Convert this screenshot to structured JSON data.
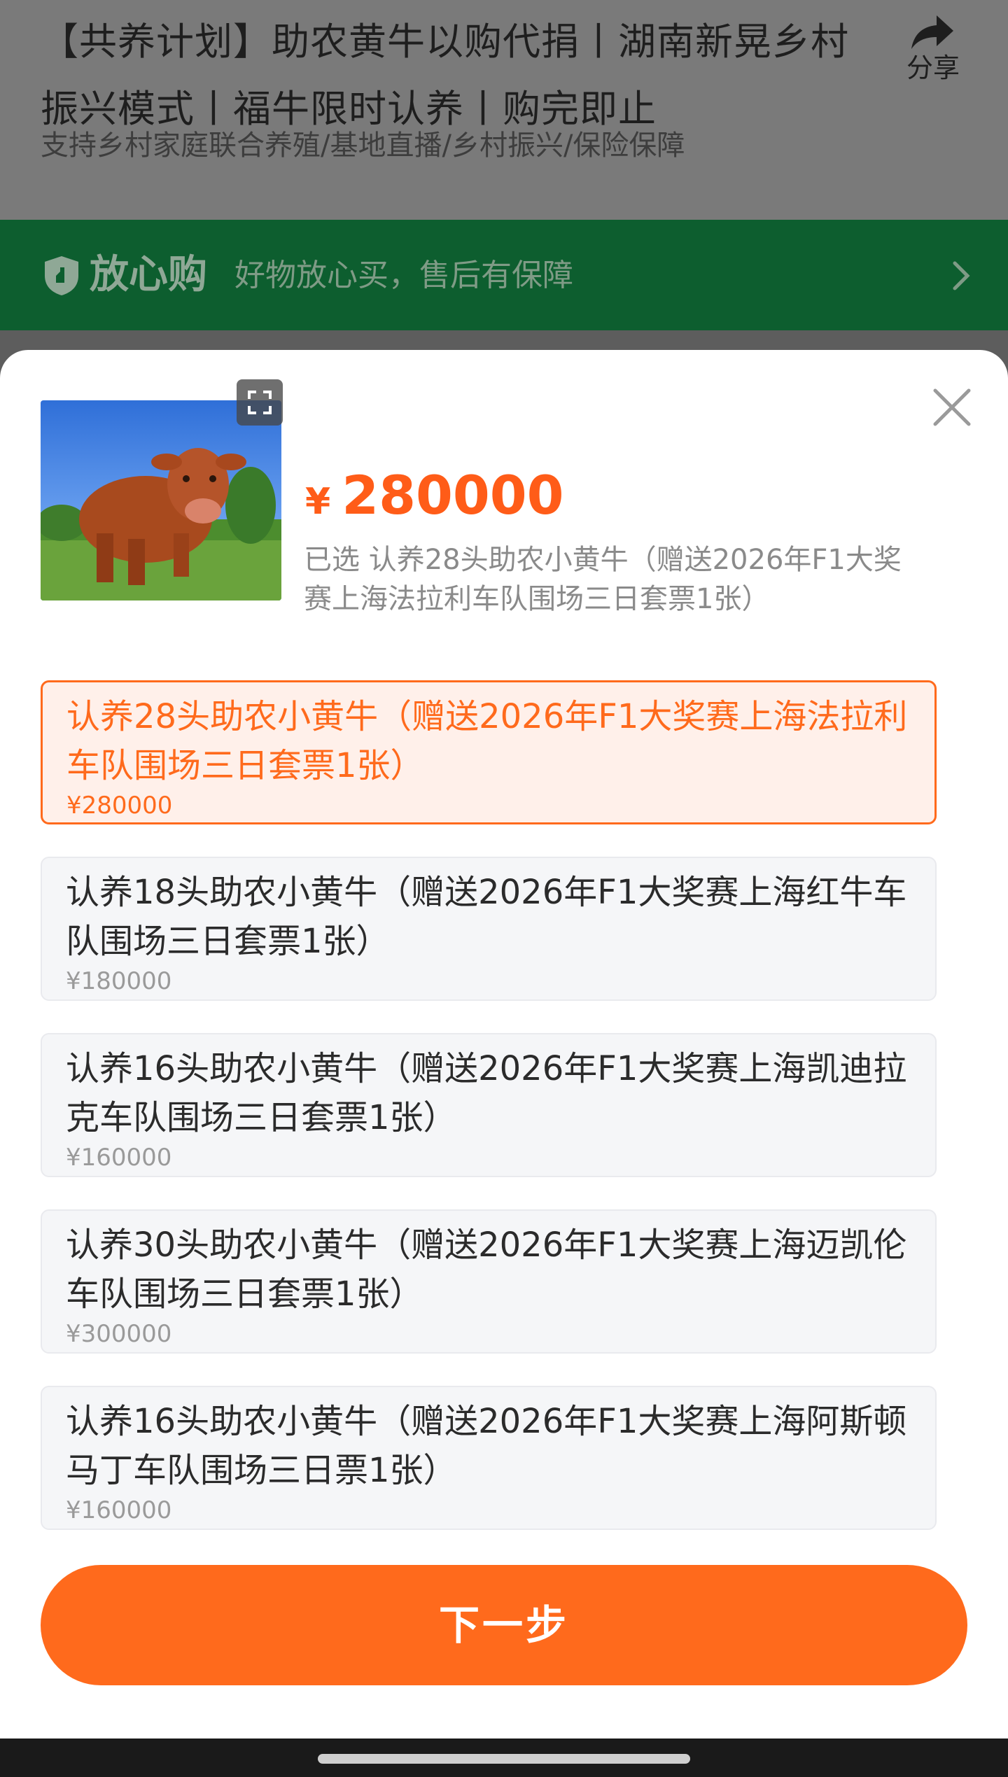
{
  "background": {
    "title": "【共养计划】助农黄牛以购代捐丨湖南新晃乡村振兴模式丨福牛限时认养丨购完即止",
    "subtitle": "支持乡村家庭联合养殖/基地直播/乡村振兴/保险保障",
    "share_label": "分享",
    "assurance": {
      "title": "放心购",
      "description": "好物放心买，售后有保障"
    }
  },
  "sheet": {
    "currency": "¥",
    "price": "280000",
    "selected_text": "已选 认养28头助农小黄牛（赠送2026年F1大奖赛上海法拉利车队围场三日套票1张）",
    "options": [
      {
        "name": "认养28头助农小黄牛（赠送2026年F1大奖赛上海法拉利车队围场三日套票1张）",
        "price": "¥280000",
        "selected": true
      },
      {
        "name": "认养18头助农小黄牛（赠送2026年F1大奖赛上海红牛车队围场三日套票1张）",
        "price": "¥180000",
        "selected": false
      },
      {
        "name": "认养16头助农小黄牛（赠送2026年F1大奖赛上海凯迪拉克车队围场三日套票1张）",
        "price": "¥160000",
        "selected": false
      },
      {
        "name": "认养30头助农小黄牛（赠送2026年F1大奖赛上海迈凯伦车队围场三日套票1张）",
        "price": "¥300000",
        "selected": false
      },
      {
        "name": "认养16头助农小黄牛（赠送2026年F1大奖赛上海阿斯顿马丁车队围场三日票1张）",
        "price": "¥160000",
        "selected": false
      }
    ],
    "next_button": "下一步"
  },
  "colors": {
    "accent": "#ff6a1c",
    "assurance_bar": "#0d5e2f",
    "selected_bg": "#fff0ea"
  },
  "icons": [
    "share-icon",
    "shield-icon",
    "chevron-right-icon",
    "close-icon",
    "expand-icon"
  ]
}
